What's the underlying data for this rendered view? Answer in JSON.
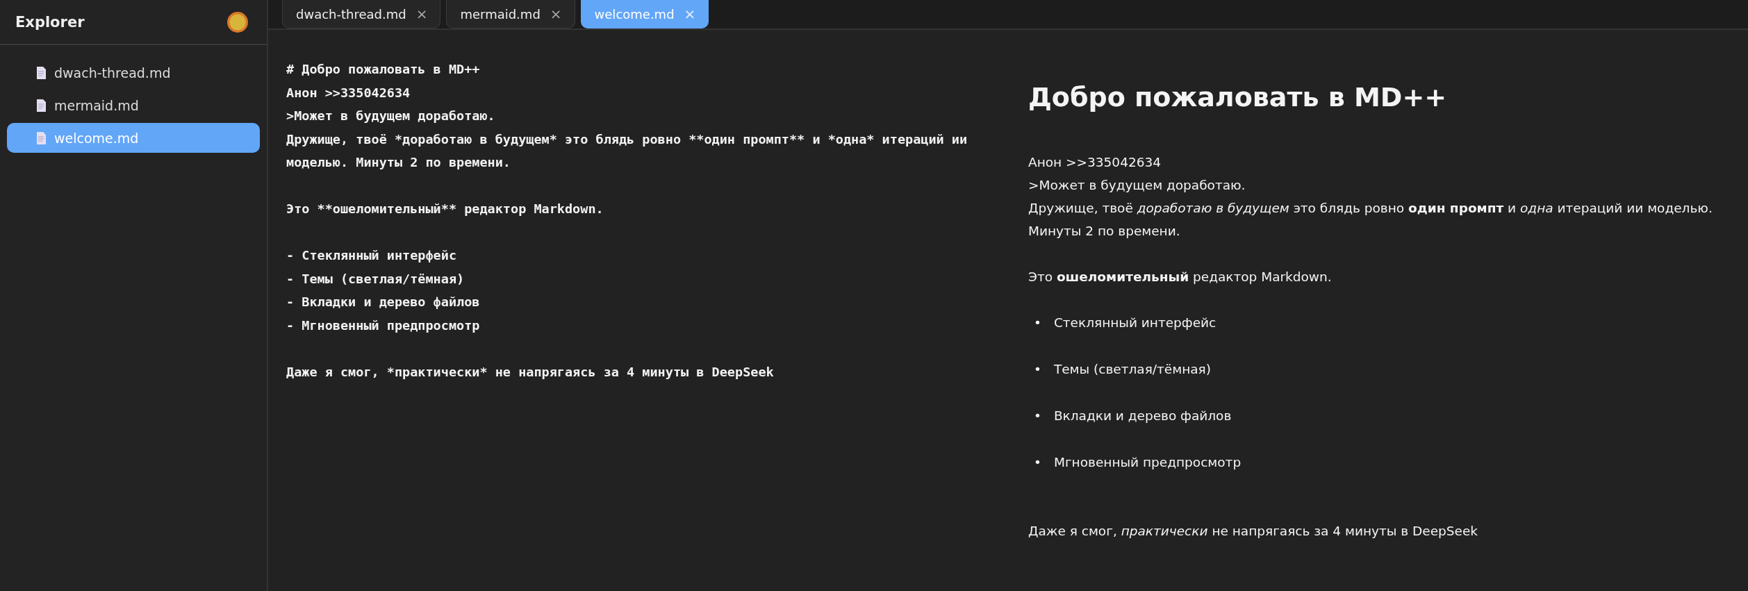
{
  "sidebar": {
    "title": "Explorer",
    "files": [
      {
        "name": "dwach-thread.md",
        "selected": false
      },
      {
        "name": "mermaid.md",
        "selected": false
      },
      {
        "name": "welcome.md",
        "selected": true
      }
    ]
  },
  "tabs": [
    {
      "label": "dwach-thread.md",
      "close": "×",
      "selected": false
    },
    {
      "label": "mermaid.md",
      "close": "×",
      "selected": false
    },
    {
      "label": "welcome.md",
      "close": "×",
      "selected": true
    }
  ],
  "editor": {
    "blocks": [
      [
        "# Добро пожаловать в MD++",
        "Анон >>335042634",
        ">Может в будущем доработаю.",
        "Дружище, твоё *доработаю в будущем* это блядь ровно **один промпт** и *одна* итераций ии моделью. Минуты 2 по времени."
      ],
      [
        "Это **ошеломительный** редактор Markdown."
      ],
      [
        "- Стеклянный интерфейс",
        "- Темы (светлая/тёмная)",
        "- Вкладки и дерево файлов",
        "- Мгновенный предпросмотр"
      ],
      [
        "Даже я смог, *практически* не напрягаясь за 4 минуты в DeepSeek"
      ]
    ]
  },
  "preview": {
    "heading": "Добро пожаловать в MD++",
    "blocks": [
      {
        "kind": "lines",
        "lines": [
          "Анон >>335042634",
          ">Может в будущем доработаю.",
          "Дружище, твоё *доработаю в будущем* это блядь ровно **один промпт** и *одна* итераций ии моделью. Минуты 2 по времени."
        ]
      },
      {
        "kind": "paragraph",
        "text": "Это **ошеломительный** редактор Markdown."
      },
      {
        "kind": "list",
        "bullet": "•",
        "items": [
          "Стеклянный интерфейс",
          "Темы (светлая/тёмная)",
          "Вкладки и дерево файлов",
          "Мгновенный предпросмотр"
        ]
      },
      {
        "kind": "paragraph",
        "text": "Даже я смог, *практически* не напрягаясь за 4 минуты в DeepSeek"
      }
    ]
  }
}
